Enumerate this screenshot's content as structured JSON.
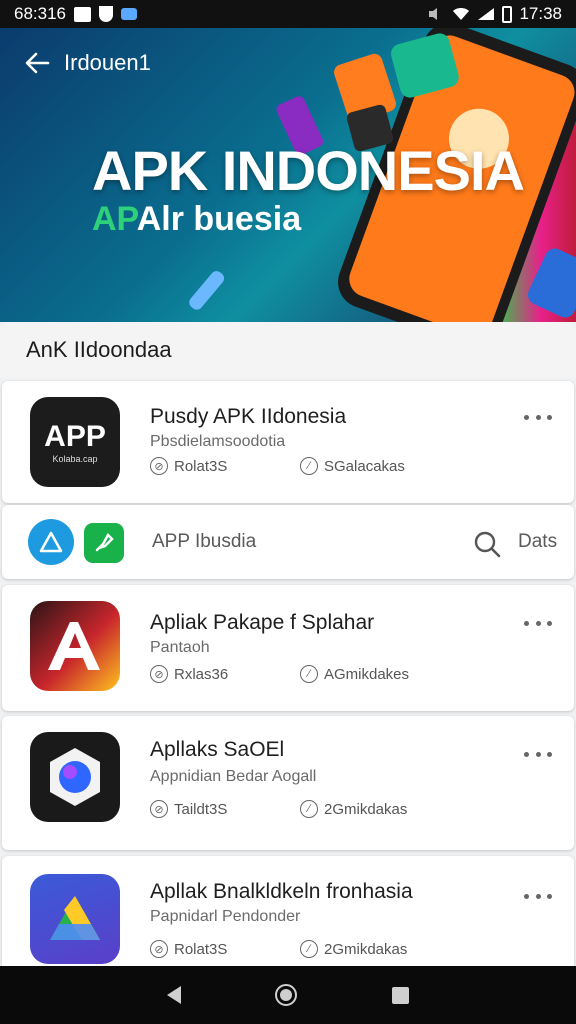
{
  "status_bar": {
    "time_left": "68:316",
    "time_right": "17:38"
  },
  "header": {
    "nav_title": "Irdouen1",
    "hero_title": "APK INDONESIA",
    "hero_subtitle_green": "AP",
    "hero_subtitle_rest": "Alr buesia"
  },
  "section": {
    "title": "AnK IIdoondaa"
  },
  "apps": [
    {
      "title": "Pusdy APK IIdonesia",
      "subtitle": "Pbsdielamsoodotia",
      "meta1": "Rolat3S",
      "meta2": "SGalacakas",
      "icon_text": "APP",
      "icon_sub": "Kolaba.cap"
    },
    {
      "title": "Apliak Pakape f Splahar",
      "subtitle": "Pantaoh",
      "meta1": "Rxlas36",
      "meta2": "AGmikdakes"
    },
    {
      "title": "Apllaks SaOEl",
      "subtitle": "Appnidian Bedar Aogall",
      "meta1": "Taildt3S",
      "meta2": "2Gmikdakas"
    },
    {
      "title": "Apllak Bnalkldkeln fronhasia",
      "subtitle": "Papnidarl Pendonder",
      "meta1": "Rolat3S",
      "meta2": "2Gmikdakas"
    }
  ],
  "search_strip": {
    "text": "APP Ibusdia",
    "right_label": "Dats"
  },
  "colors": {
    "accent_blue": "#1e9be0",
    "accent_green": "#19b24a"
  }
}
